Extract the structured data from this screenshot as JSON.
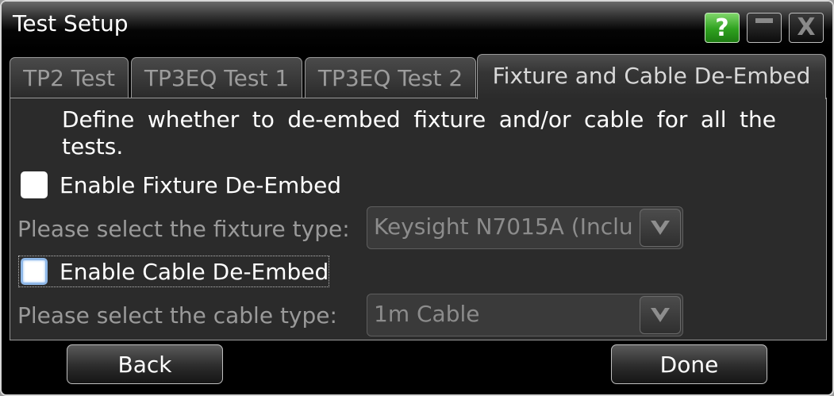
{
  "window": {
    "title": "Test Setup",
    "help_label": "?",
    "close_label": "X"
  },
  "tabs": [
    {
      "label": "TP2 Test",
      "active": false
    },
    {
      "label": "TP3EQ Test 1",
      "active": false
    },
    {
      "label": "TP3EQ Test 2",
      "active": false
    },
    {
      "label": "Fixture and Cable De-Embed",
      "active": true
    }
  ],
  "panel": {
    "description": "Define whether to de-embed fixture and/or cable for all the tests.",
    "fixture": {
      "checkbox_label": "Enable Fixture De-Embed",
      "checked": false,
      "select_label": "Please select the fixture type:",
      "select_value": "Keysight N7015A (Inclu"
    },
    "cable": {
      "checkbox_label": "Enable Cable De-Embed",
      "checked": false,
      "select_label": "Please select the cable type:",
      "select_value": "1m Cable"
    }
  },
  "footer": {
    "back_label": "Back",
    "done_label": "Done"
  },
  "icons": {
    "help": "help-icon",
    "minimize": "minimize-icon",
    "close": "close-icon",
    "dropdown": "chevron-down-icon"
  },
  "colors": {
    "help_button": "#2fa11f",
    "panel_bg": "#2b2b2b",
    "text": "#ffffff",
    "disabled_text": "#9a9a9a"
  }
}
